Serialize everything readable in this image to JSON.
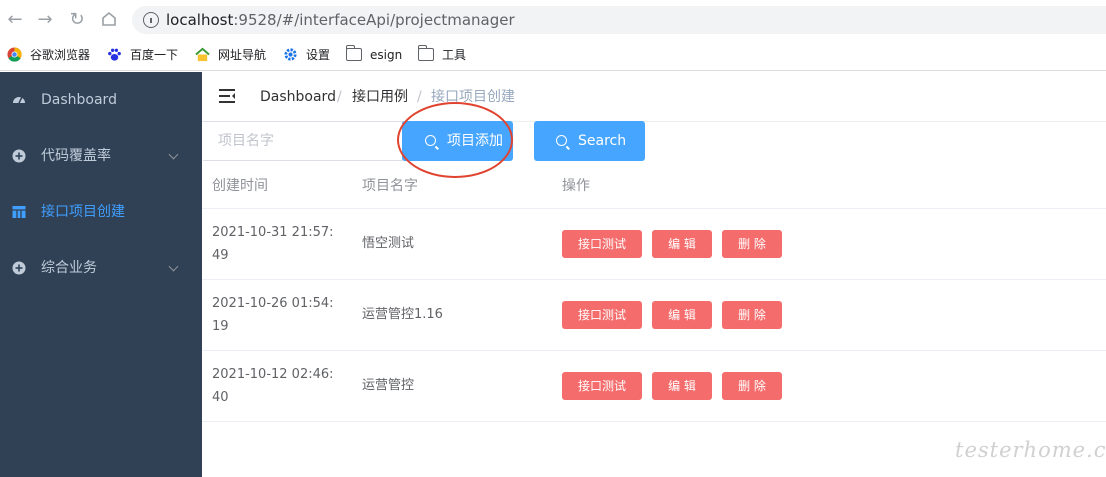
{
  "browser": {
    "url_host": "localhost",
    "url_path": ":9528/#/interfaceApi/projectmanager",
    "bookmarks": [
      "谷歌浏览器",
      "百度一下",
      "网址导航",
      "设置",
      "esign",
      "工具"
    ]
  },
  "sidebar": {
    "items": [
      {
        "label": "Dashboard",
        "icon": "dashboard-icon"
      },
      {
        "label": "代码覆盖率",
        "icon": "circle-plus-icon",
        "expandable": true
      },
      {
        "label": "接口项目创建",
        "icon": "table-icon",
        "active": true
      },
      {
        "label": "综合业务",
        "icon": "circle-plus-icon",
        "expandable": true
      }
    ]
  },
  "breadcrumb": [
    "Dashboard",
    "接口用例",
    "接口项目创建"
  ],
  "toolbar": {
    "search_placeholder": "项目名字",
    "add_label": "项目添加",
    "search_label": "Search"
  },
  "table": {
    "headers": [
      "创建时间",
      "项目名字",
      "操作"
    ],
    "rows": [
      {
        "time": "2021-10-31 21:57:49",
        "name": "悟空测试"
      },
      {
        "time": "2021-10-26 01:54:19",
        "name": "运营管控1.16"
      },
      {
        "time": "2021-10-12 02:46:40",
        "name": "运营管控"
      }
    ],
    "actions": [
      "接口测试",
      "编 辑",
      "删 除"
    ]
  },
  "colors": {
    "sidebar_bg": "#304156",
    "sidebar_active": "#409eff",
    "primary": "#46a6ff",
    "danger": "#f56c6c",
    "annotation": "#e0432f"
  },
  "watermark": "testerhome.com"
}
